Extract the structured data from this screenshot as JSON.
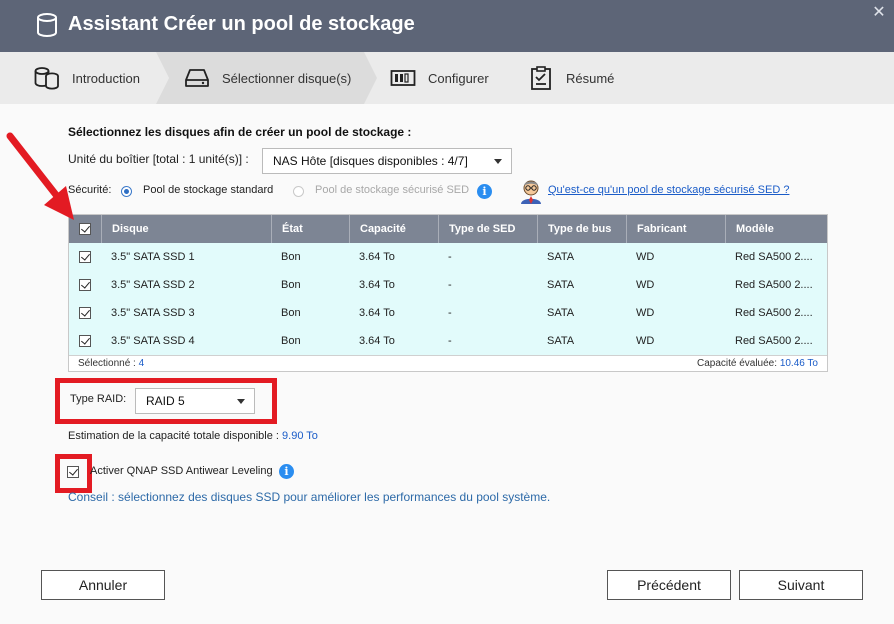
{
  "window": {
    "title": "Assistant Créer un pool de stockage",
    "close_glyph": "✕"
  },
  "steps": [
    {
      "label": "Introduction",
      "icon": "database-icon"
    },
    {
      "label": "Sélectionner disque(s)",
      "icon": "disk-drive-icon",
      "active": true
    },
    {
      "label": "Configurer",
      "icon": "raid-config-icon"
    },
    {
      "label": "Résumé",
      "icon": "clipboard-icon"
    }
  ],
  "main": {
    "heading": "Sélectionnez les disques afin de créer un pool de stockage :",
    "unit_label": "Unité du boîtier [total : 1 unité(s)] :",
    "unit_select": "NAS Hôte [disques disponibles : 4/7]",
    "security_label": "Sécurité:",
    "security_options": [
      {
        "label": "Pool de stockage standard",
        "selected": true
      },
      {
        "label": "Pool de stockage sécurisé SED",
        "selected": false,
        "disabled": true
      }
    ],
    "info_glyph": "i",
    "sed_link": "Qu'est-ce qu'un pool de stockage sécurisé SED ?"
  },
  "table": {
    "columns": [
      "Disque",
      "État",
      "Capacité",
      "Type de SED",
      "Type de bus",
      "Fabricant",
      "Modèle"
    ],
    "rows": [
      {
        "disk": "3.5\" SATA SSD 1",
        "state": "Bon",
        "capacity": "3.64 To",
        "sed": "-",
        "bus": "SATA",
        "maker": "WD",
        "model": "Red SA500 2...."
      },
      {
        "disk": "3.5\" SATA SSD 2",
        "state": "Bon",
        "capacity": "3.64 To",
        "sed": "-",
        "bus": "SATA",
        "maker": "WD",
        "model": "Red SA500 2...."
      },
      {
        "disk": "3.5\" SATA SSD 3",
        "state": "Bon",
        "capacity": "3.64 To",
        "sed": "-",
        "bus": "SATA",
        "maker": "WD",
        "model": "Red SA500 2...."
      },
      {
        "disk": "3.5\" SATA SSD 4",
        "state": "Bon",
        "capacity": "3.64 To",
        "sed": "-",
        "bus": "SATA",
        "maker": "WD",
        "model": "Red SA500 2...."
      }
    ],
    "footer": {
      "selected_label": "Sélectionné :",
      "selected_count": "4",
      "capacity_label": "Capacité évaluée:",
      "capacity_value": "10.46 To"
    }
  },
  "raid": {
    "label": "Type RAID:",
    "value": "RAID 5"
  },
  "estimate": {
    "label": "Estimation de la capacité totale disponible :",
    "value": "9.90 To"
  },
  "antiwear": {
    "label": "Activer QNAP SSD Antiwear Leveling",
    "checked": true
  },
  "tip": "Conseil : sélectionnez des disques SSD pour améliorer les performances du pool système.",
  "buttons": {
    "cancel": "Annuler",
    "previous": "Précédent",
    "next": "Suivant"
  },
  "colors": {
    "titlebar": "#5d6577",
    "table_header": "#7d8594",
    "row_bg": "#e2fbfb",
    "highlight": "#e31b23",
    "accent_blue": "#1a5cc8"
  }
}
